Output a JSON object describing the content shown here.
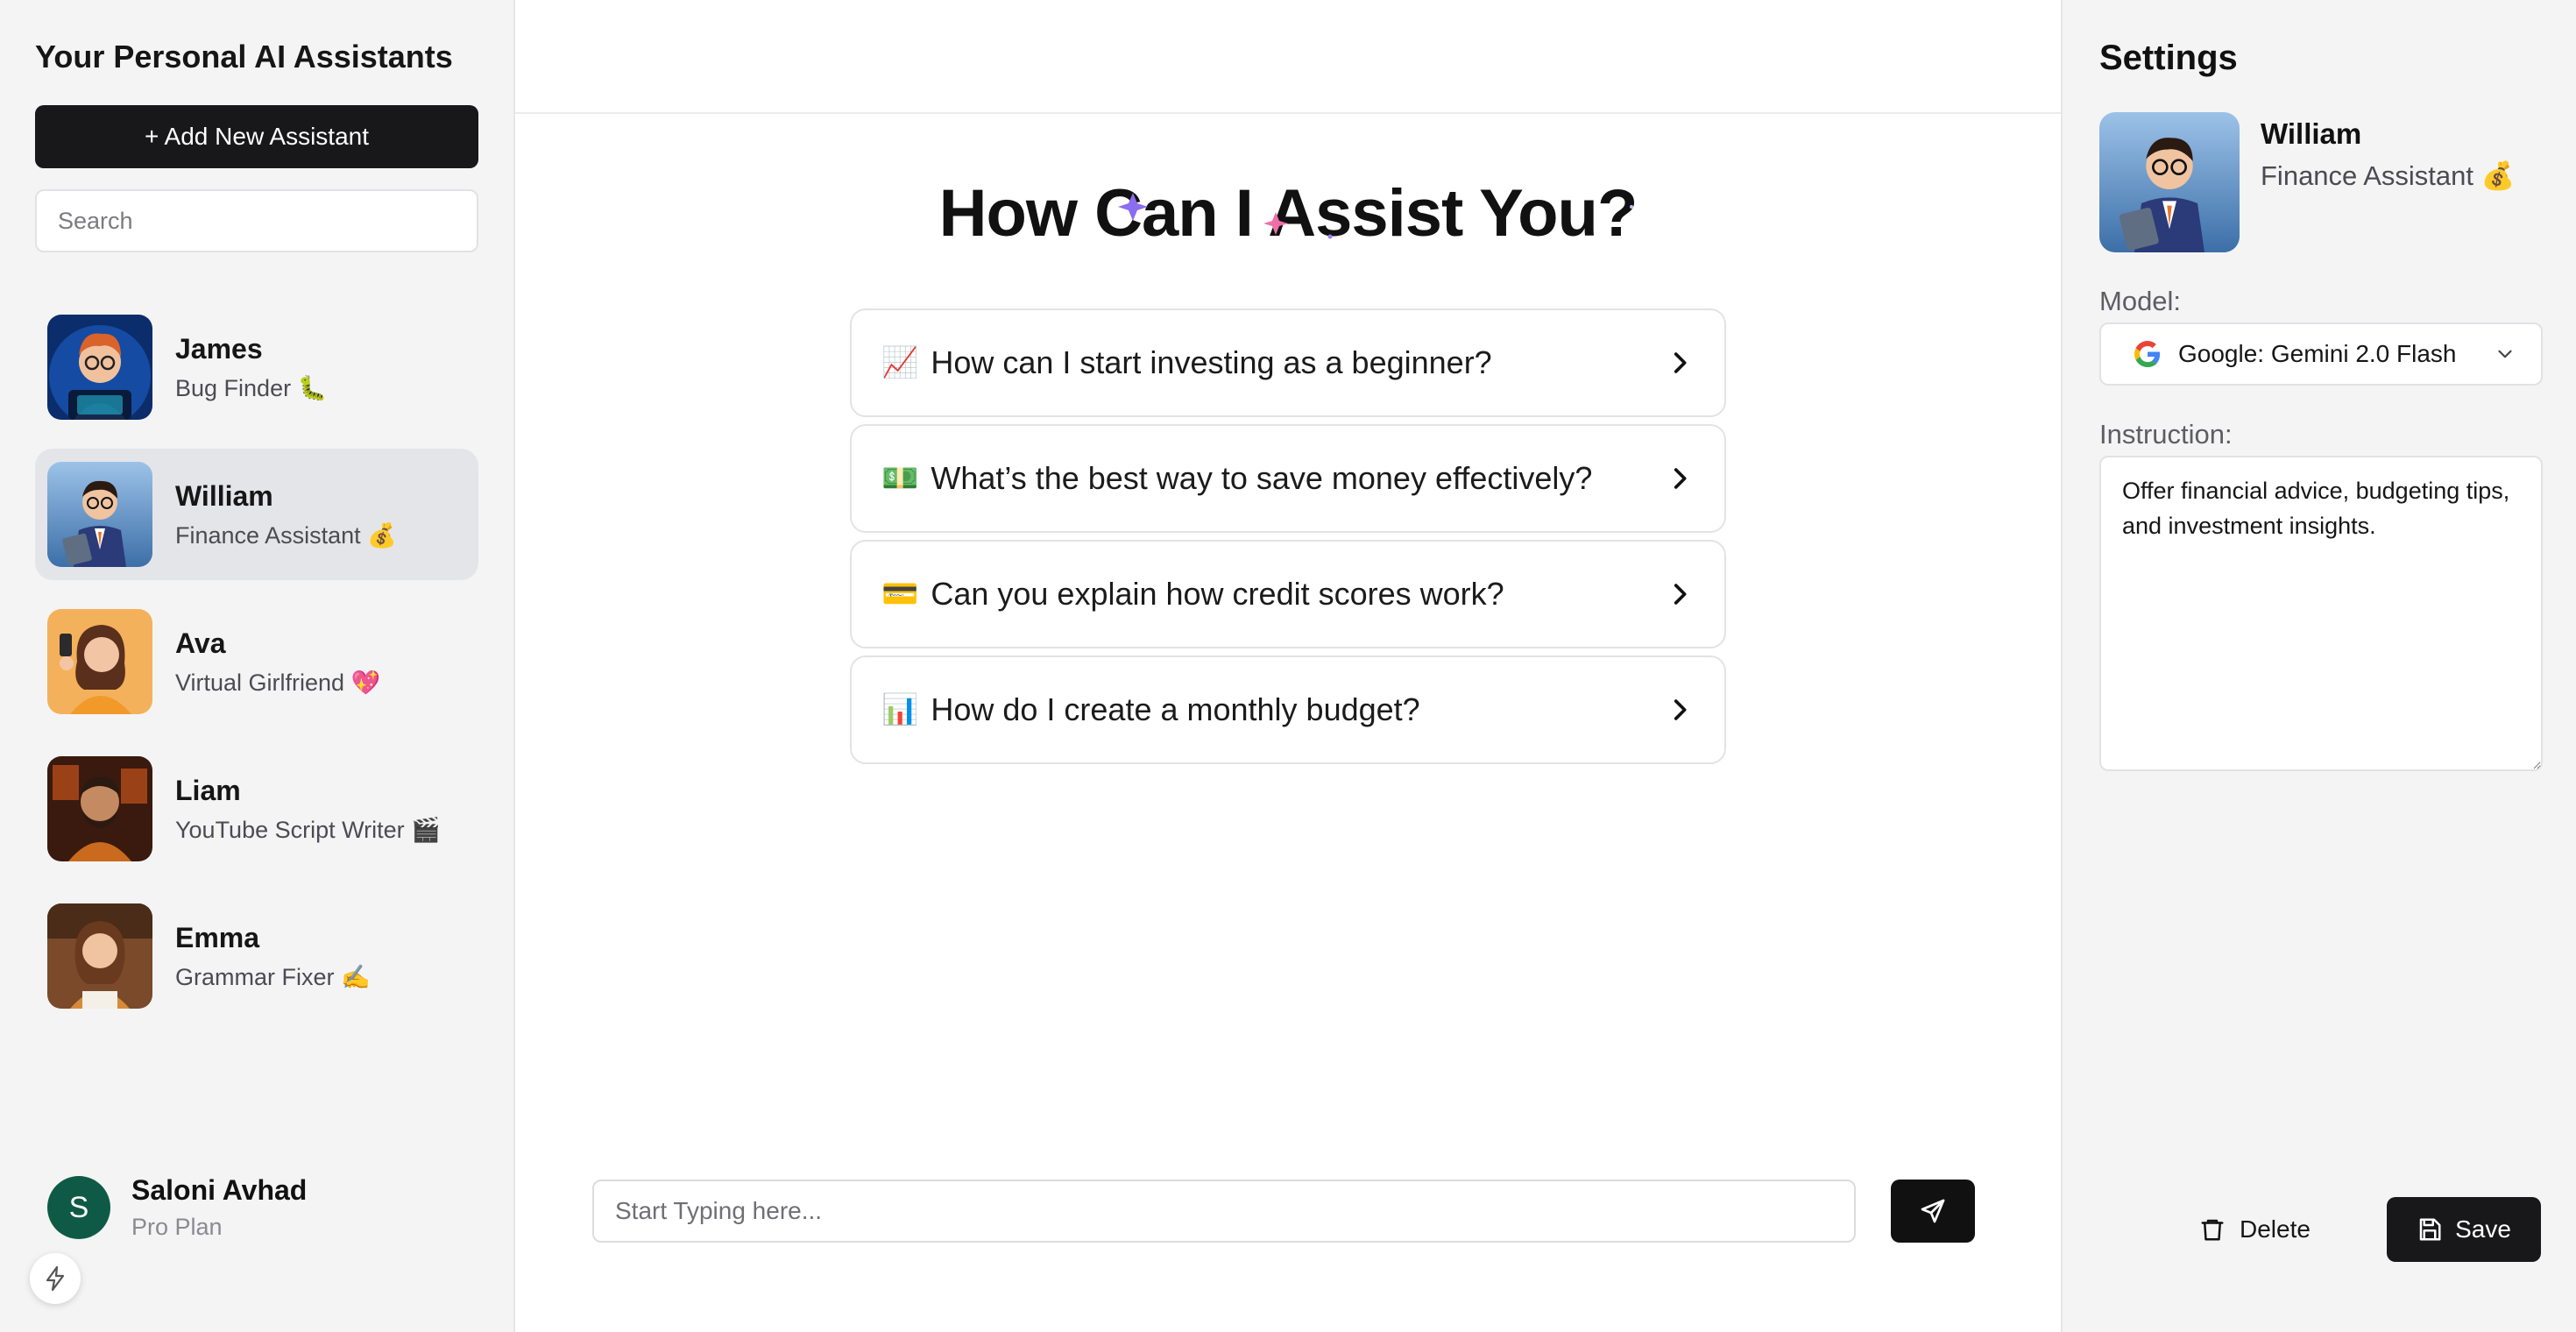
{
  "sidebar": {
    "title": "Your Personal AI Assistants",
    "add_button": "+ Add New Assistant",
    "search_placeholder": "Search",
    "assistants": [
      {
        "name": "James",
        "role": "Bug Finder 🐛",
        "active": false
      },
      {
        "name": "William",
        "role": "Finance Assistant 💰",
        "active": true
      },
      {
        "name": "Ava",
        "role": "Virtual Girlfriend 💖",
        "active": false
      },
      {
        "name": "Liam",
        "role": "YouTube Script Writer 🎬",
        "active": false
      },
      {
        "name": "Emma",
        "role": "Grammar Fixer ✍️",
        "active": false
      }
    ],
    "user": {
      "initial": "S",
      "name": "Saloni Avhad",
      "plan": "Pro Plan"
    }
  },
  "main": {
    "heading": "How Can I Assist You?",
    "suggestions": [
      {
        "emoji": "📈",
        "text": "How can I start investing as a beginner?"
      },
      {
        "emoji": "💵",
        "text": "What’s the best way to save money effectively?"
      },
      {
        "emoji": "💳",
        "text": "Can you explain how credit scores work?"
      },
      {
        "emoji": "📊",
        "text": "How do I create a monthly budget?"
      }
    ],
    "input_placeholder": "Start Typing here..."
  },
  "settings": {
    "title": "Settings",
    "assistant_name": "William",
    "assistant_role": "Finance Assistant 💰",
    "model_label": "Model:",
    "model_value": "Google: Gemini 2.0 Flash",
    "instruction_label": "Instruction:",
    "instruction_value": "Offer financial advice, budgeting tips, and investment insights.",
    "delete_label": "Delete",
    "save_label": "Save"
  },
  "colors": {
    "primary_dark": "#18181b",
    "sidebar_bg": "#f4f4f5",
    "active_item_bg": "#e4e5e9",
    "user_avatar_bg": "#0f5a46"
  }
}
